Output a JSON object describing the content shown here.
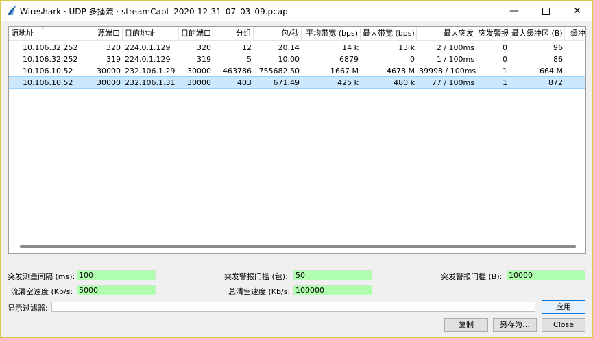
{
  "window": {
    "title": "Wireshark · UDP 多播流 · streamCapt_2020-12-31_07_03_09.pcap"
  },
  "table": {
    "columns": [
      "源地址",
      "源端口",
      "目的地址",
      "目的端口",
      "分组",
      "包/秒",
      "平均带宽 (bps)",
      "最大带宽 (bps)",
      "最大突发",
      "突发警报",
      "最大缓冲区 (B)",
      "缓冲"
    ],
    "rows": [
      [
        "10.106.32.252",
        "320",
        "224.0.1.129",
        "320",
        "12",
        "20.14",
        "14 k",
        "13 k",
        "2 / 100ms",
        "0",
        "96"
      ],
      [
        "10.106.32.252",
        "319",
        "224.0.1.129",
        "319",
        "5",
        "10.00",
        "6879",
        "0",
        "1 / 100ms",
        "0",
        "86"
      ],
      [
        "10.106.10.52",
        "30000",
        "232.106.1.29",
        "30000",
        "463786",
        "755682.50",
        "1667 M",
        "4678 M",
        "39998 / 100ms",
        "1",
        "664 M"
      ],
      [
        "10.106.10.52",
        "30000",
        "232.106.1.31",
        "30000",
        "403",
        "671.49",
        "425 k",
        "480 k",
        "77 / 100ms",
        "1",
        "872"
      ]
    ],
    "selected_row": 3
  },
  "settings": {
    "burst_interval_label": "突发测量间隔 (ms):",
    "burst_interval_value": "100",
    "burst_alarm_packets_label": "突发警报门槛 (包):",
    "burst_alarm_packets_value": "50",
    "buffer_alarm_label": "突发警报门槛 (B):",
    "buffer_alarm_value": "10000",
    "stream_drain_label": "流清空速度 (Kb/s:",
    "stream_drain_value": "5000",
    "total_drain_label": "总清空速度 (Kb/s:",
    "total_drain_value": "100000"
  },
  "filter": {
    "label": "显示过滤器:",
    "value": ""
  },
  "buttons": {
    "apply": "应用",
    "copy": "复制",
    "save_as": "另存为…",
    "close": "Close"
  },
  "colors": {
    "selected_row": "#cce8ff",
    "field_bg": "#afffaf"
  }
}
